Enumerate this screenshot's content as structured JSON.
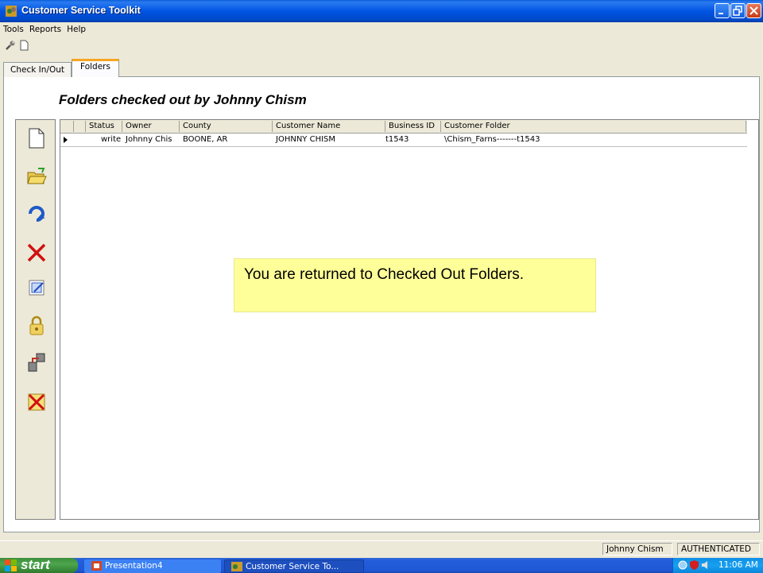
{
  "window": {
    "title": "Customer Service Toolkit"
  },
  "menu": [
    "Tools",
    "Reports",
    "Help"
  ],
  "tabs": [
    {
      "label": "Check In/Out"
    },
    {
      "label": "Folders"
    }
  ],
  "page_title": "Folders checked out by Johnny Chism",
  "grid": {
    "columns": [
      "Status",
      "Owner",
      "County",
      "Customer Name",
      "Business ID",
      "Customer Folder"
    ],
    "rows": [
      {
        "status": "write",
        "owner": "Johnny Chis",
        "county": "BOONE, AR",
        "customer_name": "JOHNNY CHISM",
        "business_id": "t1543",
        "customer_folder": "\\Chism_Farns-------t1543"
      }
    ]
  },
  "callout": "You are returned to Checked Out Folders.",
  "status": {
    "user": "Johnny Chism",
    "auth": "AUTHENTICATED"
  },
  "taskbar": {
    "start": "start",
    "tasks": [
      "Presentation4",
      "Customer Service To..."
    ],
    "clock": "11:06 AM"
  },
  "colors": {
    "titlebar": "#0054E3",
    "callout_bg": "#FFFF99",
    "taskbar": "#245EDB",
    "start": "#3C8E3C",
    "active_tab": "#F5A623"
  }
}
